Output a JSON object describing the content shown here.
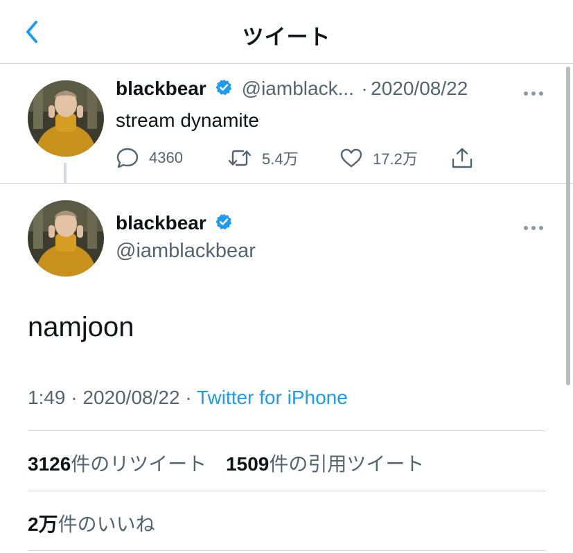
{
  "header": {
    "title": "ツイート",
    "back_icon": "chevron-left-icon",
    "accent_color": "#1d9bf0"
  },
  "parent_tweet": {
    "display_name": "blackbear",
    "handle_truncated": "@iamblack...",
    "separator": "·",
    "date": "2020/08/22",
    "text": "stream dynamite",
    "actions": {
      "replies": "4360",
      "retweets": "5.4万",
      "likes": "17.2万"
    }
  },
  "main_tweet": {
    "display_name": "blackbear",
    "handle": "@iamblackbear",
    "text": "namjoon",
    "time": "1:49",
    "separator": "·",
    "date": "2020/08/22",
    "source_separator": "·",
    "source": "Twitter for iPhone"
  },
  "stats": {
    "retweets_num": "3126",
    "retweets_label": "件のリツイート",
    "quotes_num": "1509",
    "quotes_label": "件の引用ツイート",
    "likes_num": "2万",
    "likes_label": "件のいいね"
  },
  "colors": {
    "verified": "#1d9bf0",
    "muted_text": "#536471",
    "divider": "#d0d4d8"
  }
}
